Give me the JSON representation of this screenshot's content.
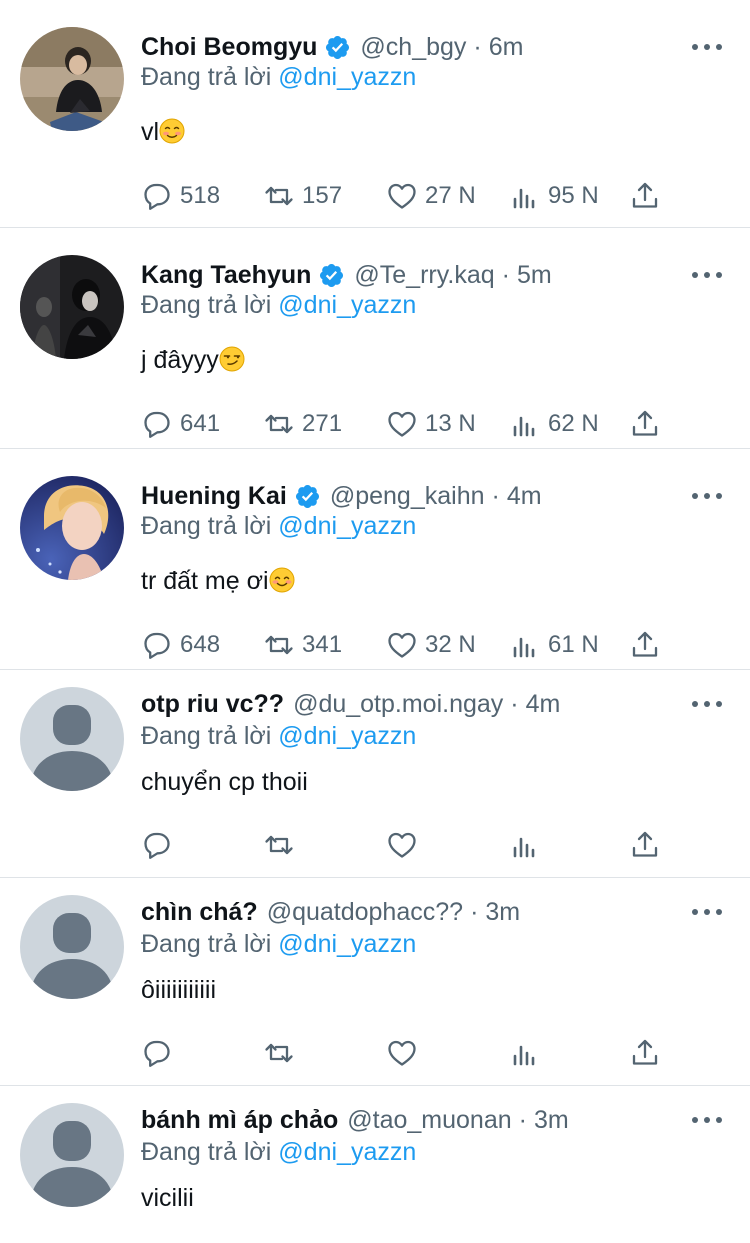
{
  "reply_prefix": "Đang trả lời",
  "tweets": [
    {
      "name": "Choi Beomgyu",
      "verified": true,
      "handle": "@ch_bgy",
      "dot": "·",
      "time": "6m",
      "reply_to": "@dni_yazzn",
      "text": "vl",
      "emoji": "smiling-face-icon",
      "avatar": "photo-person-sitting",
      "stats": {
        "replies": "518",
        "retweets": "157",
        "likes": "27 N",
        "views": "95 N"
      }
    },
    {
      "name": "Kang Taehyun",
      "verified": true,
      "handle": "@Te_rry.kaq",
      "dot": "·",
      "time": "5m",
      "reply_to": "@dni_yazzn",
      "text": "j đâyyy",
      "emoji": "smirking-face-icon",
      "avatar": "photo-dark-portrait",
      "stats": {
        "replies": "641",
        "retweets": "271",
        "likes": "13 N",
        "views": "62 N"
      }
    },
    {
      "name": "Huening Kai",
      "verified": true,
      "handle": "@peng_kaihn",
      "dot": "·",
      "time": "4m",
      "reply_to": "@dni_yazzn",
      "text": "tr đất mẹ ơi",
      "emoji": "blushing-face-icon",
      "avatar": "photo-blond-portrait",
      "stats": {
        "replies": "648",
        "retweets": "341",
        "likes": "32 N",
        "views": "61 N"
      }
    },
    {
      "name": "otp riu vc??",
      "verified": false,
      "handle": "@du_otp.moi.ngay",
      "dot": "·",
      "time": "4m",
      "reply_to": "@dni_yazzn",
      "text": "chuyển cp thoii",
      "emoji": "",
      "avatar": "default-avatar",
      "stats": {
        "replies": "",
        "retweets": "",
        "likes": "",
        "views": ""
      }
    },
    {
      "name": "chìn chá?",
      "verified": false,
      "handle": "@quatdophacc??",
      "dot": "·",
      "time": "3m",
      "reply_to": "@dni_yazzn",
      "text": "ôiiiiiiiiiii",
      "emoji": "",
      "avatar": "default-avatar",
      "stats": {
        "replies": "",
        "retweets": "",
        "likes": "",
        "views": ""
      }
    },
    {
      "name": "bánh mì áp chảo",
      "verified": false,
      "handle": "@tao_muonan",
      "dot": "·",
      "time": "3m",
      "reply_to": "@dni_yazzn",
      "text": "vicilii",
      "emoji": "",
      "avatar": "default-avatar",
      "stats": null
    }
  ],
  "colors": {
    "text": "#0f1419",
    "secondary": "#536471",
    "link": "#1d9bf0",
    "verified": "#1d9bf0",
    "divider": "#dfe3e7",
    "default_avatar_bg": "#cdd5dc",
    "default_avatar_fg": "#687684"
  }
}
